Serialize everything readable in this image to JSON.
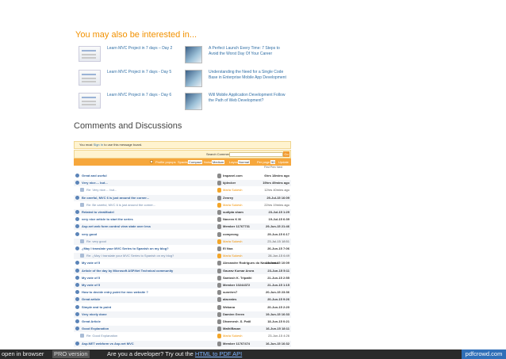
{
  "related": {
    "title": "You may also be interested in...",
    "items": [
      {
        "title": "Learn MVC Project in 7 days – Day 2"
      },
      {
        "title": "Learn MVC Project in 7 days - Day 5"
      },
      {
        "title": "Learn MVC Project in 7 days - Day 6"
      },
      {
        "title": "A Perfect Launch Every Time: 7 Steps to Avoid the Worst Day Of Your Career"
      },
      {
        "title": "Understanding the Need for a Single Code Base in Enterprise Mobile App Development"
      },
      {
        "title": "Will Mobile Application Development Follow the Path of Web Development?"
      }
    ]
  },
  "comments": {
    "title": "Comments and Discussions",
    "signin_prefix": "You must ",
    "signin_link": "Sign In",
    "signin_suffix": " to use this message board.",
    "search_label": "Search Comments",
    "search_go": "Go",
    "filter": {
      "profile": "Profile popups",
      "spacing": "Spacing",
      "spacing_value": "Compact",
      "noise": "Noise",
      "noise_value": "Medium",
      "layout": "Layout",
      "layout_value": "Normal",
      "per_page": "Per page",
      "per_page_value": "50",
      "update": "Update"
    },
    "pager": "First  Prev  Next"
  },
  "threads": [
    {
      "subject": "Great and useful",
      "author": "Irapanel.com",
      "date": "6hrs 18mins ago",
      "reply": false
    },
    {
      "subject": "Very nice.... but...",
      "author": "kjdecker",
      "date": "19hrs 49mins ago",
      "reply": false
    },
    {
      "subject": "Re: Very nice.... but...",
      "author": "Marla Sukesh",
      "date": "12hrs 40mins ago",
      "reply": true
    },
    {
      "subject": "Be careful, MVC 6 is just around the corner...",
      "author": "Zenrey",
      "date": "29-Jul-15 16:09",
      "reply": false
    },
    {
      "subject": "Re: Be careful, MVC 6 is just around the corner...",
      "author": "Marla Sukesh",
      "date": "22hrs 19mins ago",
      "reply": true
    },
    {
      "subject": "Related to viewModel",
      "author": "sudipta sham",
      "date": "23-Jul-15 1:29",
      "reply": false
    },
    {
      "subject": "very nice article to start the series",
      "author": "Naveen K M",
      "date": "19-Jul-15 6:39",
      "reply": false
    },
    {
      "subject": "Asp.net web form control view state over less",
      "author": "Member 11767731",
      "date": "29-Jun-15 21:46",
      "reply": false
    },
    {
      "subject": "very good",
      "author": "comprong",
      "date": "29-Jun-15 6:17",
      "reply": false
    },
    {
      "subject": "Re: very good",
      "author": "Marla Sukesh",
      "date": "23-Jul-15 18:51",
      "reply": true
    },
    {
      "subject": "¿May I translate your MVC Series to Spanish on my blog?",
      "author": "El Noa",
      "date": "26-Jun-15 7:06",
      "reply": false
    },
    {
      "subject": "Re: ¿May I translate your MVC Series to Spanish on my blog?",
      "author": "Marla Sukesh",
      "date": "28-Jun-15 6:49",
      "reply": true
    },
    {
      "subject": "My vote of 5",
      "author": "Alexandre Rodrigues do Nascimento",
      "date": "23-Jun-15 10:09",
      "reply": false
    },
    {
      "subject": "Article of the day by Microsoft ASP.Net Technical community",
      "author": "Gaurav Kumar Arora",
      "date": "23-Jun-15 5:11",
      "reply": false
    },
    {
      "subject": "My vote of 5",
      "author": "Santosh K. Tripathi",
      "date": "21-Jun-15 2:55",
      "reply": false
    },
    {
      "subject": "My vote of 5",
      "author": "Member 10244372",
      "date": "21-Jun-15 1:15",
      "reply": false
    },
    {
      "subject": "How to decide entry point for mvc website ?",
      "author": "sunnhrn7",
      "date": "20-Jun-15 23:36",
      "reply": false
    },
    {
      "subject": "Great article",
      "author": "alacrates",
      "date": "20-Jun-15 9:26",
      "reply": false
    },
    {
      "subject": "Simple and to point",
      "author": "Wekana",
      "date": "20-Jun-15 2:20",
      "reply": false
    },
    {
      "subject": "Very nicely done",
      "author": "Damien Green",
      "date": "19-Jun-15 16:33",
      "reply": false
    },
    {
      "subject": "Great Article",
      "author": "Dharmesh .S. Patil",
      "date": "18-Jun-15 0:21",
      "reply": false
    },
    {
      "subject": "Good Explanation",
      "author": "MathiBasan",
      "date": "16-Jun-15 18:11",
      "reply": false
    },
    {
      "subject": "Re: Good Explanation",
      "author": "Marla Sukesh",
      "date": "23-Jun-15 4:26",
      "reply": true
    },
    {
      "subject": "Asp.NET webform vs Asp.net MVC",
      "author": "Member 11767474",
      "date": "16-Jun-15 16:32",
      "reply": false
    }
  ],
  "footer": {
    "open": "open in browser",
    "pro": "PRO version",
    "dev_text": "Are you a developer? Try out the ",
    "dev_link": "HTML to PDF API",
    "brand": "pdfcrowd.com"
  }
}
